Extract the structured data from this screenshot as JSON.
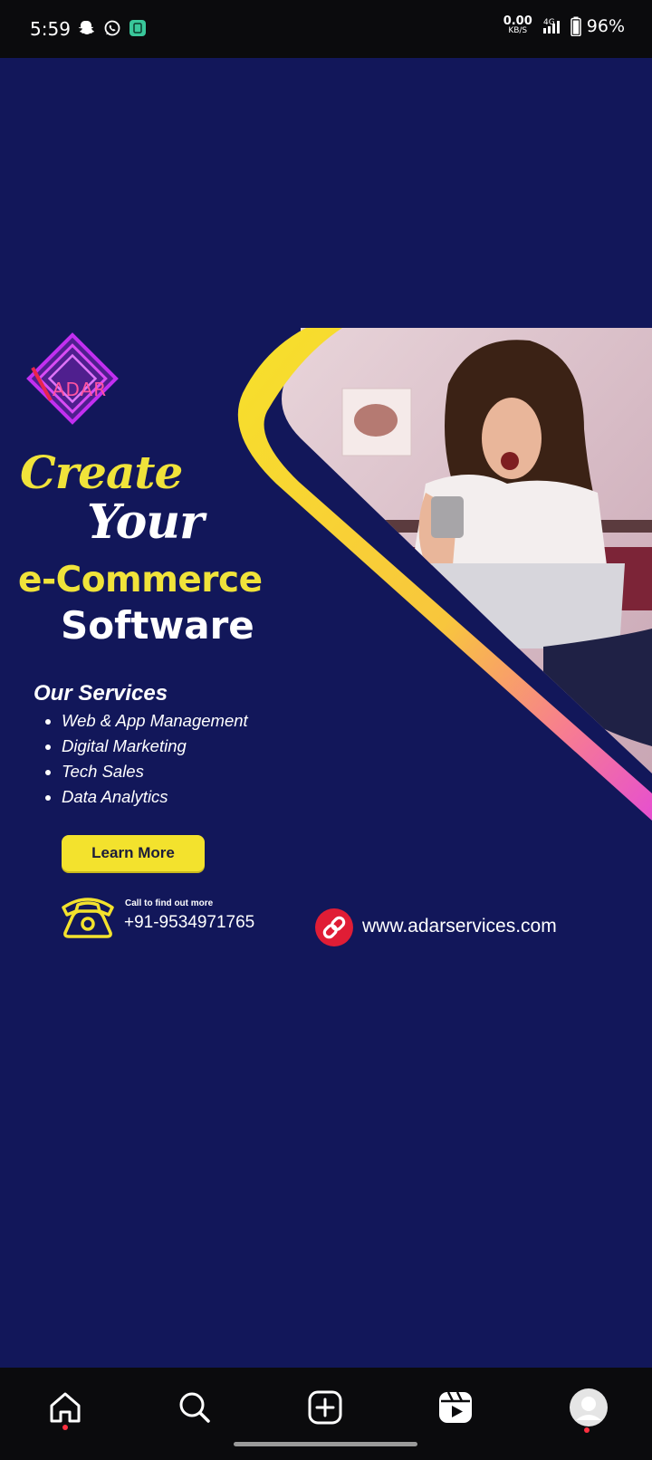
{
  "status_bar": {
    "time": "5:59",
    "net_speed_value": "0.00",
    "net_speed_unit": "KB/S",
    "network": "4G",
    "battery": "96%",
    "icons": [
      "snapchat-icon",
      "whatsapp-icon",
      "app-notification-icon",
      "signal-icon",
      "battery-icon"
    ]
  },
  "post": {
    "logo_text": "ADAR",
    "headline": {
      "line1": "Create",
      "line2": "Your",
      "line3": "e-Commerce",
      "line4": "Software"
    },
    "services_title": "Our Services",
    "services": [
      "Web & App Management",
      "Digital Marketing",
      "Tech Sales",
      "Data Analytics"
    ],
    "cta_label": "Learn More",
    "call_caption": "Call to find out more",
    "phone": "+91-9534971765",
    "website": "www.adarservices.com",
    "colors": {
      "background": "#12175a",
      "accent_yellow": "#f3e22d",
      "accent_pink": "#e64fd0",
      "logo_purple": "#b02bd6"
    }
  },
  "bottom_nav": {
    "items": [
      "home-icon",
      "search-icon",
      "create-icon",
      "reels-icon",
      "profile-avatar"
    ]
  }
}
